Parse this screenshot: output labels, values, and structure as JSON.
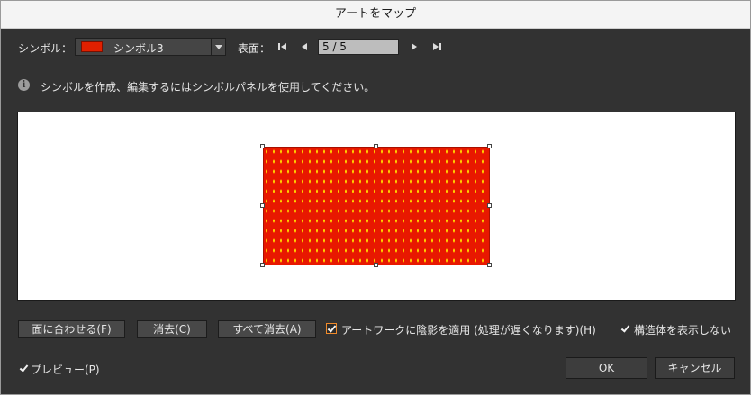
{
  "window": {
    "title": "アートをマップ"
  },
  "symbol": {
    "label": "シンボル：",
    "selected": "シンボル3",
    "swatch_color": "#e02000"
  },
  "surface": {
    "label": "表面：",
    "page_value": "5 / 5",
    "nav_icons": [
      "first-page-icon",
      "prev-page-icon",
      "next-page-icon",
      "last-page-icon"
    ]
  },
  "info": {
    "icon": "info-icon",
    "text": "シンボルを作成、編集するにはシンボルパネルを使用してください。"
  },
  "art": {
    "fill_color": "#e81800",
    "dot_color": "#ffd000"
  },
  "buttons": {
    "fit": "面に合わせる(F)",
    "clear": "消去(C)",
    "clear_all": "すべて消去(A)",
    "ok": "OK",
    "cancel": "キャンセル"
  },
  "options": {
    "shade_label": "アートワークに陰影を適用 (処理が遅くなります)(H)",
    "shade_checked": true,
    "hide_geometry_label": "構造体を表示しない",
    "hide_geometry_checked": true,
    "preview_label": "プレビュー(P)",
    "preview_checked": true
  }
}
